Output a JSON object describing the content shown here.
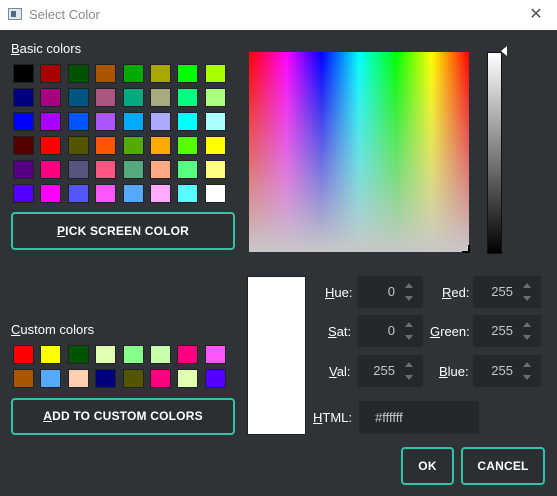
{
  "window": {
    "title": "Select Color",
    "close_glyph": "✕",
    "app_icon": "app-icon"
  },
  "basic_colors": {
    "label_accel": "B",
    "label_rest": "asic colors",
    "swatches": [
      "#000000",
      "#a80000",
      "#005400",
      "#aa5500",
      "#00aa00",
      "#a8a800",
      "#00ff00",
      "#a8ff00",
      "#000080",
      "#aa0080",
      "#005680",
      "#aa5680",
      "#00aa80",
      "#aaaa80",
      "#00ff80",
      "#aaff80",
      "#0000ff",
      "#aa00ff",
      "#0055ff",
      "#aa55ff",
      "#00aaff",
      "#aaaaff",
      "#00ffff",
      "#aaffff",
      "#550000",
      "#ff0000",
      "#555500",
      "#ff5500",
      "#55aa00",
      "#ffaa00",
      "#55ff00",
      "#ffff00",
      "#550080",
      "#ff0080",
      "#555580",
      "#ff5580",
      "#55aa80",
      "#ffaa80",
      "#55ff80",
      "#ffff80",
      "#5500ff",
      "#ff00ff",
      "#5555ff",
      "#ff55ff",
      "#55aaff",
      "#ffaaff",
      "#55ffff",
      "#ffffff"
    ]
  },
  "pick_button": {
    "accel": "P",
    "rest": "ICK SCREEN COLOR"
  },
  "custom_colors": {
    "label_accel": "C",
    "label_rest": "ustom colors",
    "swatches": [
      "#ff0000",
      "#ffff00",
      "#005400",
      "#e0ffb0",
      "#88ff88",
      "#c8ffaa",
      "#ff0080",
      "#ff55ff",
      "#aa5500",
      "#55aaff",
      "#ffd0b0",
      "#000080",
      "#555500",
      "#ff0080",
      "#e0ffb0",
      "#5500ff"
    ]
  },
  "add_button": {
    "accel": "A",
    "rest": "DD TO CUSTOM COLORS"
  },
  "fields": {
    "hue": {
      "accel": "H",
      "rest": "ue:",
      "value": "0"
    },
    "sat": {
      "accel": "S",
      "rest": "at:",
      "value": "0"
    },
    "val": {
      "accel": "V",
      "rest": "al:",
      "value": "255"
    },
    "red": {
      "accel": "R",
      "rest": "ed:",
      "value": "255"
    },
    "green": {
      "accel": "G",
      "rest": "reen:",
      "value": "255"
    },
    "blue": {
      "accel": "B",
      "rest": "lue:",
      "value": "255"
    },
    "html": {
      "accel": "H",
      "rest": "TML:",
      "value": "#ffffff"
    }
  },
  "current_color": "#ffffff",
  "accent_color": "#2fc5a8",
  "ok_label": "OK",
  "cancel_label": "CANCEL"
}
